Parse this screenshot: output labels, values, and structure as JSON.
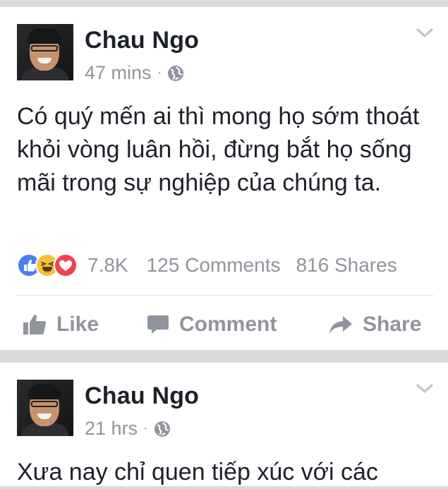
{
  "posts": [
    {
      "author": "Chau Ngo",
      "time": "47 mins",
      "separator": "·",
      "privacy_icon": "globe-icon",
      "text": "Có quý mến ai thì mong họ sớm thoát khỏi vòng luân hồi, đừng bắt họ sống mãi trong sự nghiệp của chúng ta.",
      "reactions": [
        "like",
        "haha",
        "love"
      ],
      "reaction_count": "7.8K",
      "comments": "125 Comments",
      "shares": "816 Shares",
      "actions": {
        "like": "Like",
        "comment": "Comment",
        "share": "Share"
      }
    },
    {
      "author": "Chau Ngo",
      "time": "21 hrs",
      "separator": "·",
      "privacy_icon": "globe-icon",
      "text": "Xưa nay chỉ quen tiếp xúc với các"
    }
  ],
  "colors": {
    "background": "#d9dadc",
    "card": "#ffffff",
    "text": "#1d2129",
    "meta": "#90949c",
    "like_blue": "#4a7ef0",
    "haha_yellow": "#f5c33b",
    "love_red": "#f0434f"
  }
}
